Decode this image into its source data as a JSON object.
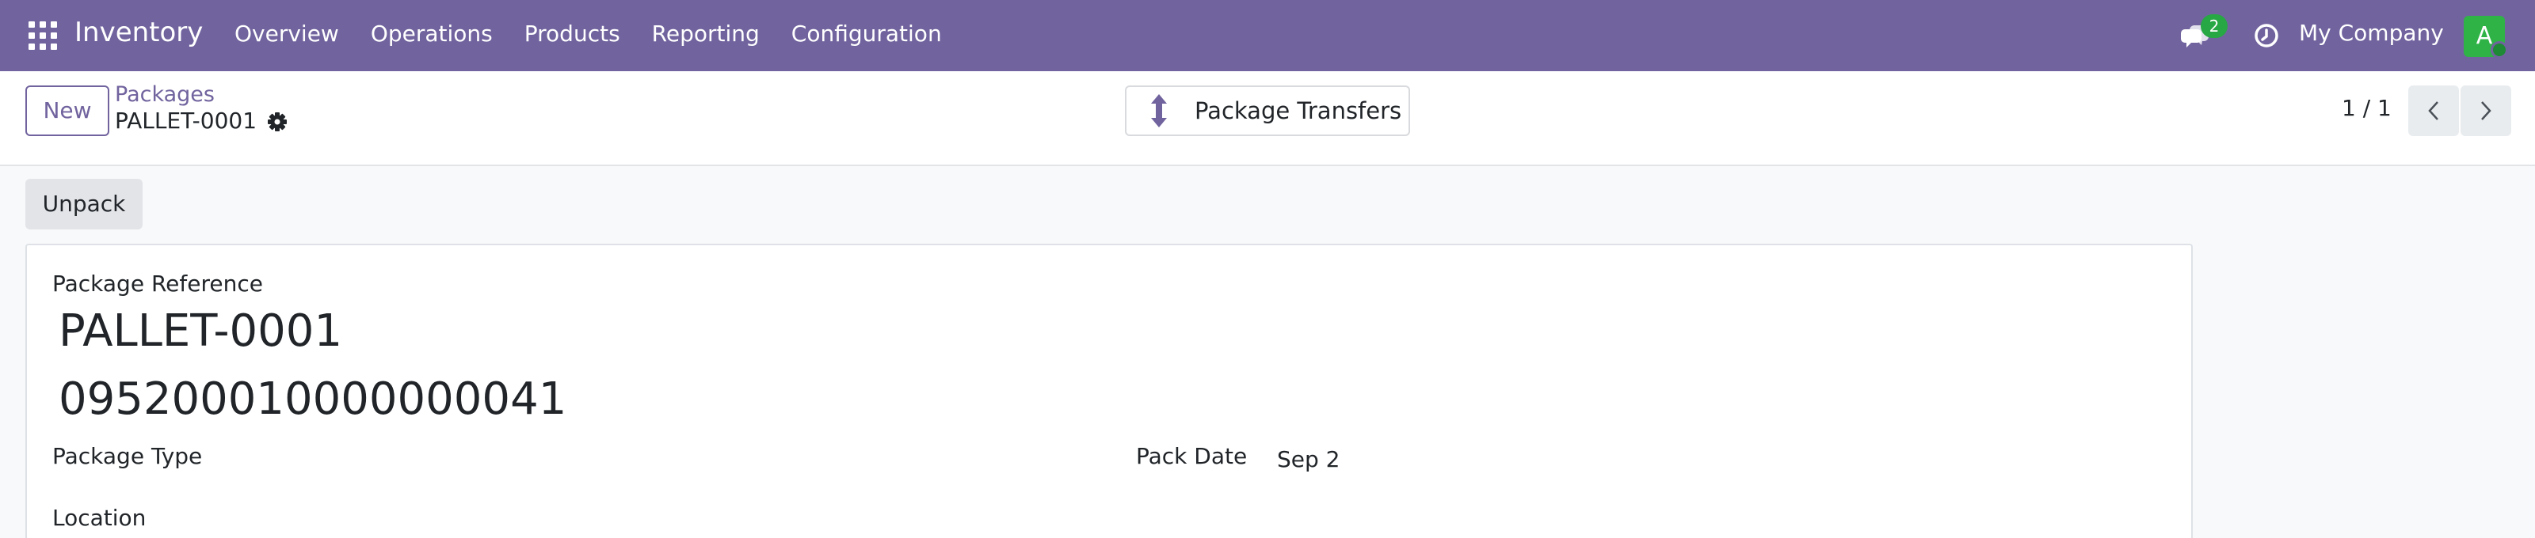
{
  "navbar": {
    "app_name": "Inventory",
    "menu": [
      "Overview",
      "Operations",
      "Products",
      "Reporting",
      "Configuration"
    ],
    "messages_count": "2",
    "company": "My Company",
    "avatar_initial": "A",
    "accent_color": "#71639e"
  },
  "control_panel": {
    "new_label": "New",
    "breadcrumb_parent": "Packages",
    "record_name": "PALLET-0001",
    "smart_button_label": "Package Transfers",
    "pager_value": "1 / 1"
  },
  "statusbar": {
    "unpack_label": "Unpack"
  },
  "form": {
    "package_reference_label": "Package Reference",
    "package_reference_value": "PALLET-0001",
    "barcode_value": "095200010000000041",
    "package_type_label": "Package Type",
    "pack_date_label": "Pack Date",
    "pack_date_value": "Sep 2",
    "location_label": "Location"
  }
}
